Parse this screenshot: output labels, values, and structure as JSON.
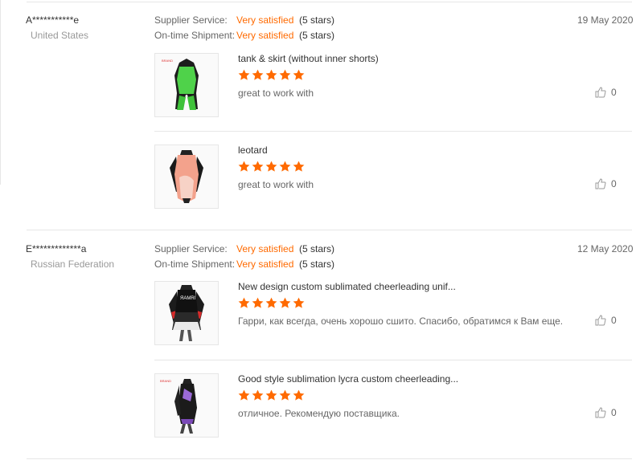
{
  "colors": {
    "accent": "#ff6a00",
    "star": "#ff6a00",
    "muted": "#999999"
  },
  "reviews": [
    {
      "user": "A***********e",
      "country": "United States",
      "supplier_label": "Supplier Service:",
      "supplier_value": "Very satisfied",
      "supplier_stars": "(5 stars)",
      "shipment_label": "On-time Shipment:",
      "shipment_value": "Very satisfied",
      "shipment_stars": "(5 stars)",
      "date": "19 May 2020",
      "products": [
        {
          "title": "tank & skirt (without inner shorts)",
          "rating": 5,
          "comment": "great to work with",
          "likes": "0",
          "image": "green-black-cheer-uniform"
        },
        {
          "title": "leotard",
          "rating": 5,
          "comment": "great to work with",
          "likes": "0",
          "image": "coral-white-leotard"
        }
      ]
    },
    {
      "user": "E*************a",
      "country": "Russian Federation",
      "supplier_label": "Supplier Service:",
      "supplier_value": "Very satisfied",
      "supplier_stars": "(5 stars)",
      "shipment_label": "On-time Shipment:",
      "shipment_value": "Very satisfied",
      "shipment_stars": "(5 stars)",
      "date": "12 May 2020",
      "products": [
        {
          "title": "New design custom sublimated cheerleading unif...",
          "rating": 5,
          "comment": "Гарри, как всегда, очень хорошо сшито. Спасибо, обратимся к Вам еще.",
          "likes": "0",
          "image": "black-red-cheer-uniform"
        },
        {
          "title": "Good style sublimation lycra custom cheerleading...",
          "rating": 5,
          "comment": "отличное. Рекомендую поставщика.",
          "likes": "0",
          "image": "black-purple-cheer-uniform"
        }
      ]
    }
  ]
}
